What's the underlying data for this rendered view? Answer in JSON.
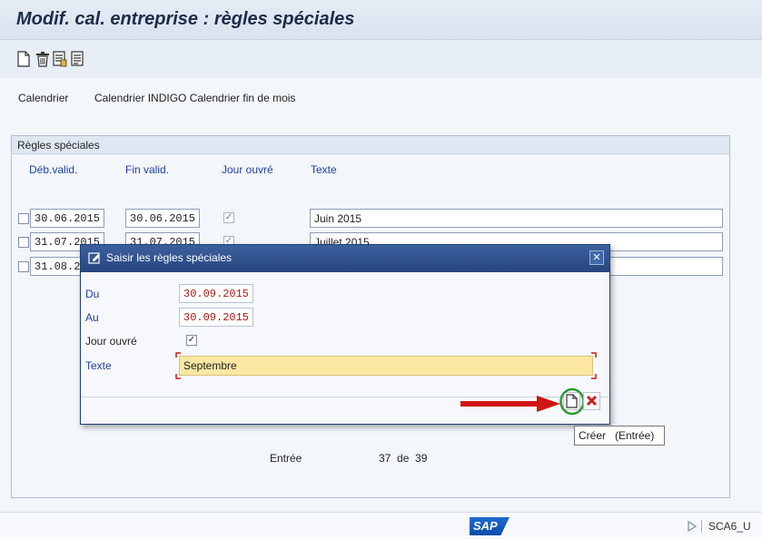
{
  "window": {
    "title": "Modif. cal. entreprise : règles spéciales"
  },
  "toolbar": {
    "icons": [
      "new-document-icon",
      "delete-icon",
      "details-icon",
      "overview-icon"
    ]
  },
  "calendar": {
    "label": "Calendrier",
    "value": "Calendrier INDIGO Calendrier fin de mois"
  },
  "group": {
    "title": "Règles spéciales"
  },
  "table": {
    "headers": [
      "Déb.valid.",
      "Fin valid.",
      "Jour ouvré",
      "Texte"
    ],
    "rows": [
      {
        "start": "30.06.2015",
        "end": "30.06.2015",
        "working_day": true,
        "text": "Juin 2015"
      },
      {
        "start": "31.07.2015",
        "end": "31.07.2015",
        "working_day": true,
        "text": "Juillet 2015"
      },
      {
        "start": "31.08.2",
        "end": "",
        "working_day": false,
        "text": ""
      }
    ]
  },
  "pagination": {
    "label": "Entrée",
    "value": "37  de  39"
  },
  "dialog": {
    "title": "Saisir les règles spéciales",
    "du_label": "Du",
    "du_value": "30.09.2015",
    "au_label": "Au",
    "au_value": "30.09.2015",
    "jour_label": "Jour ouvré",
    "jour_checked": true,
    "texte_label": "Texte",
    "texte_value": "Septembre"
  },
  "tooltip": {
    "text": "Créer   (Entrée)"
  },
  "footer": {
    "logo": "SAP",
    "system": "SCA6_U"
  },
  "colors": {
    "accent": "#27467f",
    "label_blue": "#1f3fa3",
    "arrow": "#d11515",
    "highlight_circle": "#2a9a36",
    "texte_field": "#fbe7a2"
  }
}
